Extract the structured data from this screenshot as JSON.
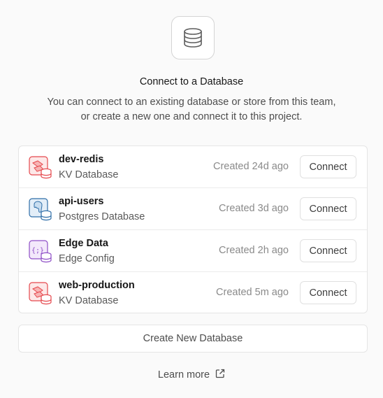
{
  "header": {
    "icon": "database-icon",
    "title": "Connect to a Database",
    "description": "You can connect to an existing database or store from this team, or create a new one and connect it to this project."
  },
  "databases": [
    {
      "name": "dev-redis",
      "type": "KV Database",
      "created": "Created 24d ago",
      "icon": "kv-database-icon",
      "color": "#e5484d",
      "connect_label": "Connect"
    },
    {
      "name": "api-users",
      "type": "Postgres Database",
      "created": "Created 3d ago",
      "icon": "postgres-database-icon",
      "color": "#2f6ea8",
      "connect_label": "Connect"
    },
    {
      "name": "Edge Data",
      "type": "Edge Config",
      "created": "Created 2h ago",
      "icon": "edge-config-icon",
      "color": "#8e4ec6",
      "connect_label": "Connect"
    },
    {
      "name": "web-production",
      "type": "KV Database",
      "created": "Created 5m ago",
      "icon": "kv-database-icon",
      "color": "#e5484d",
      "connect_label": "Connect"
    }
  ],
  "actions": {
    "create_label": "Create New Database",
    "learn_more_label": "Learn more",
    "learn_more_icon": "external-link-icon"
  }
}
